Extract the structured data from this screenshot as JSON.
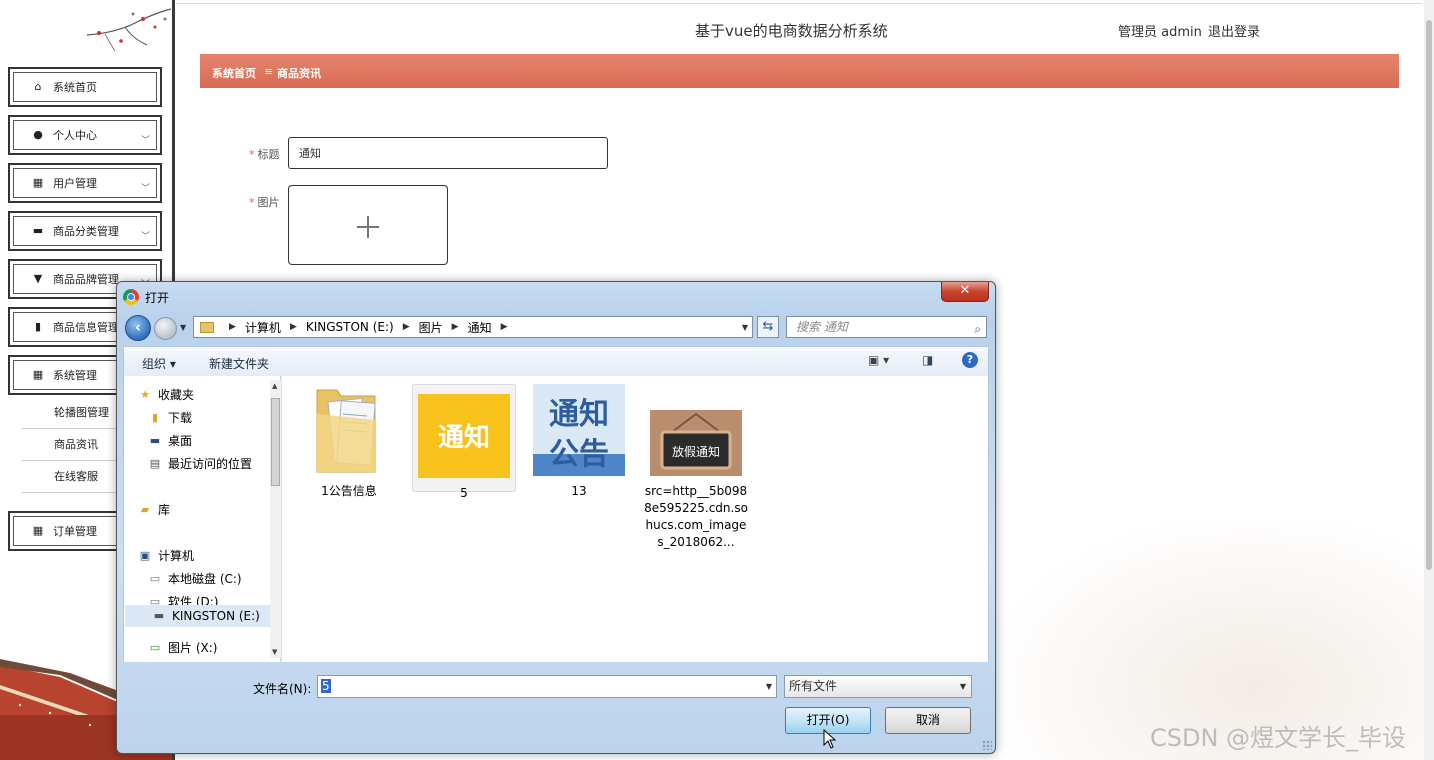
{
  "header": {
    "app_title": "基于vue的电商数据分析系统",
    "user_label": "管理员 admin",
    "logout_label": "退出登录"
  },
  "breadcrumb": {
    "home": "系统首页",
    "separator": "≡",
    "current": "商品资讯"
  },
  "sidebar": {
    "items": [
      {
        "label": "系统首页",
        "icon": "home-icon"
      },
      {
        "label": "个人中心",
        "icon": "person-icon"
      },
      {
        "label": "用户管理",
        "icon": "grid-icon"
      },
      {
        "label": "商品分类管理",
        "icon": "briefcase-icon"
      },
      {
        "label": "商品品牌管理",
        "icon": "pin-icon"
      },
      {
        "label": "商品信息管理",
        "icon": "bar-chart-icon"
      },
      {
        "label": "系统管理",
        "icon": "grid-icon"
      }
    ],
    "sub_items": [
      "轮播图管理",
      "商品资讯",
      "在线客服"
    ],
    "order_item": {
      "label": "订单管理",
      "icon": "grid-icon"
    }
  },
  "form": {
    "title_label": "标题",
    "title_value": "通知",
    "image_label": "图片"
  },
  "dialog": {
    "title": "打开",
    "close_label": "✕",
    "path": [
      "计算机",
      "KINGSTON (E:)",
      "图片",
      "通知"
    ],
    "search_placeholder": "搜索 通知",
    "toolbar": {
      "organize": "组织 ▾",
      "new_folder": "新建文件夹"
    },
    "nav": {
      "favorites": "收藏夹",
      "downloads": "下载",
      "desktop": "桌面",
      "recent": "最近访问的位置",
      "libraries": "库",
      "computer": "计算机",
      "drive_c": "本地磁盘 (C:)",
      "drive_d": "软件 (D:)",
      "drive_e": "KINGSTON (E:)",
      "drive_x": "图片 (X:)"
    },
    "files": [
      {
        "name": "1公告信息",
        "kind": "folder"
      },
      {
        "name": "5",
        "kind": "image",
        "thumb_text": "通知"
      },
      {
        "name": "13",
        "kind": "image",
        "thumb_text": "通知 公告"
      },
      {
        "name": "src=http__5b0988e595225.cdn.sohucs.com_images_2018062...",
        "kind": "image",
        "thumb_text": "放假通知"
      }
    ],
    "filename_label": "文件名(N):",
    "filename_value": "5",
    "filetype_value": "所有文件",
    "open_label": "打开(O)",
    "cancel_label": "取消"
  },
  "watermark": "CSDN @煜文学长_毕设",
  "colors": {
    "breadcrumb_bar": "#d96a52",
    "dialog_frame": "#b9d1ec",
    "accent_blue": "#2b6bc2"
  }
}
